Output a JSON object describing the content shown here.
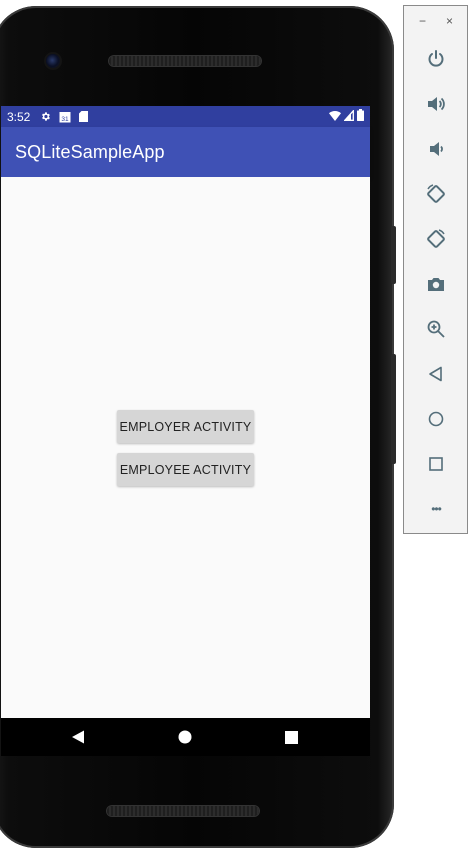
{
  "status_bar": {
    "time": "3:52",
    "icons_left": [
      "settings-icon",
      "calendar-icon",
      "sd-card-icon"
    ],
    "calendar_day": "31",
    "icons_right": [
      "wifi-icon",
      "signal-icon",
      "battery-icon"
    ]
  },
  "app_bar": {
    "title": "SQLiteSampleApp"
  },
  "main": {
    "buttons": [
      {
        "label": "EMPLOYER ACTIVITY"
      },
      {
        "label": "EMPLOYEE ACTIVITY"
      }
    ]
  },
  "nav_bar": {
    "buttons": [
      "back-icon",
      "home-icon",
      "recents-icon"
    ]
  },
  "emulator_toolbar": {
    "minimize": "−",
    "close": "×",
    "tools": [
      "power-icon",
      "volume-up-icon",
      "volume-down-icon",
      "rotate-left-icon",
      "rotate-right-icon",
      "camera-icon",
      "zoom-icon",
      "back-icon",
      "home-icon",
      "overview-icon",
      "more-icon"
    ],
    "more_label": "•••"
  },
  "colors": {
    "status_bar": "#303f9f",
    "app_bar": "#3f51b5",
    "content_bg": "#fafafa",
    "button_bg": "#d6d6d6",
    "toolbar_icon": "#546e7a"
  }
}
